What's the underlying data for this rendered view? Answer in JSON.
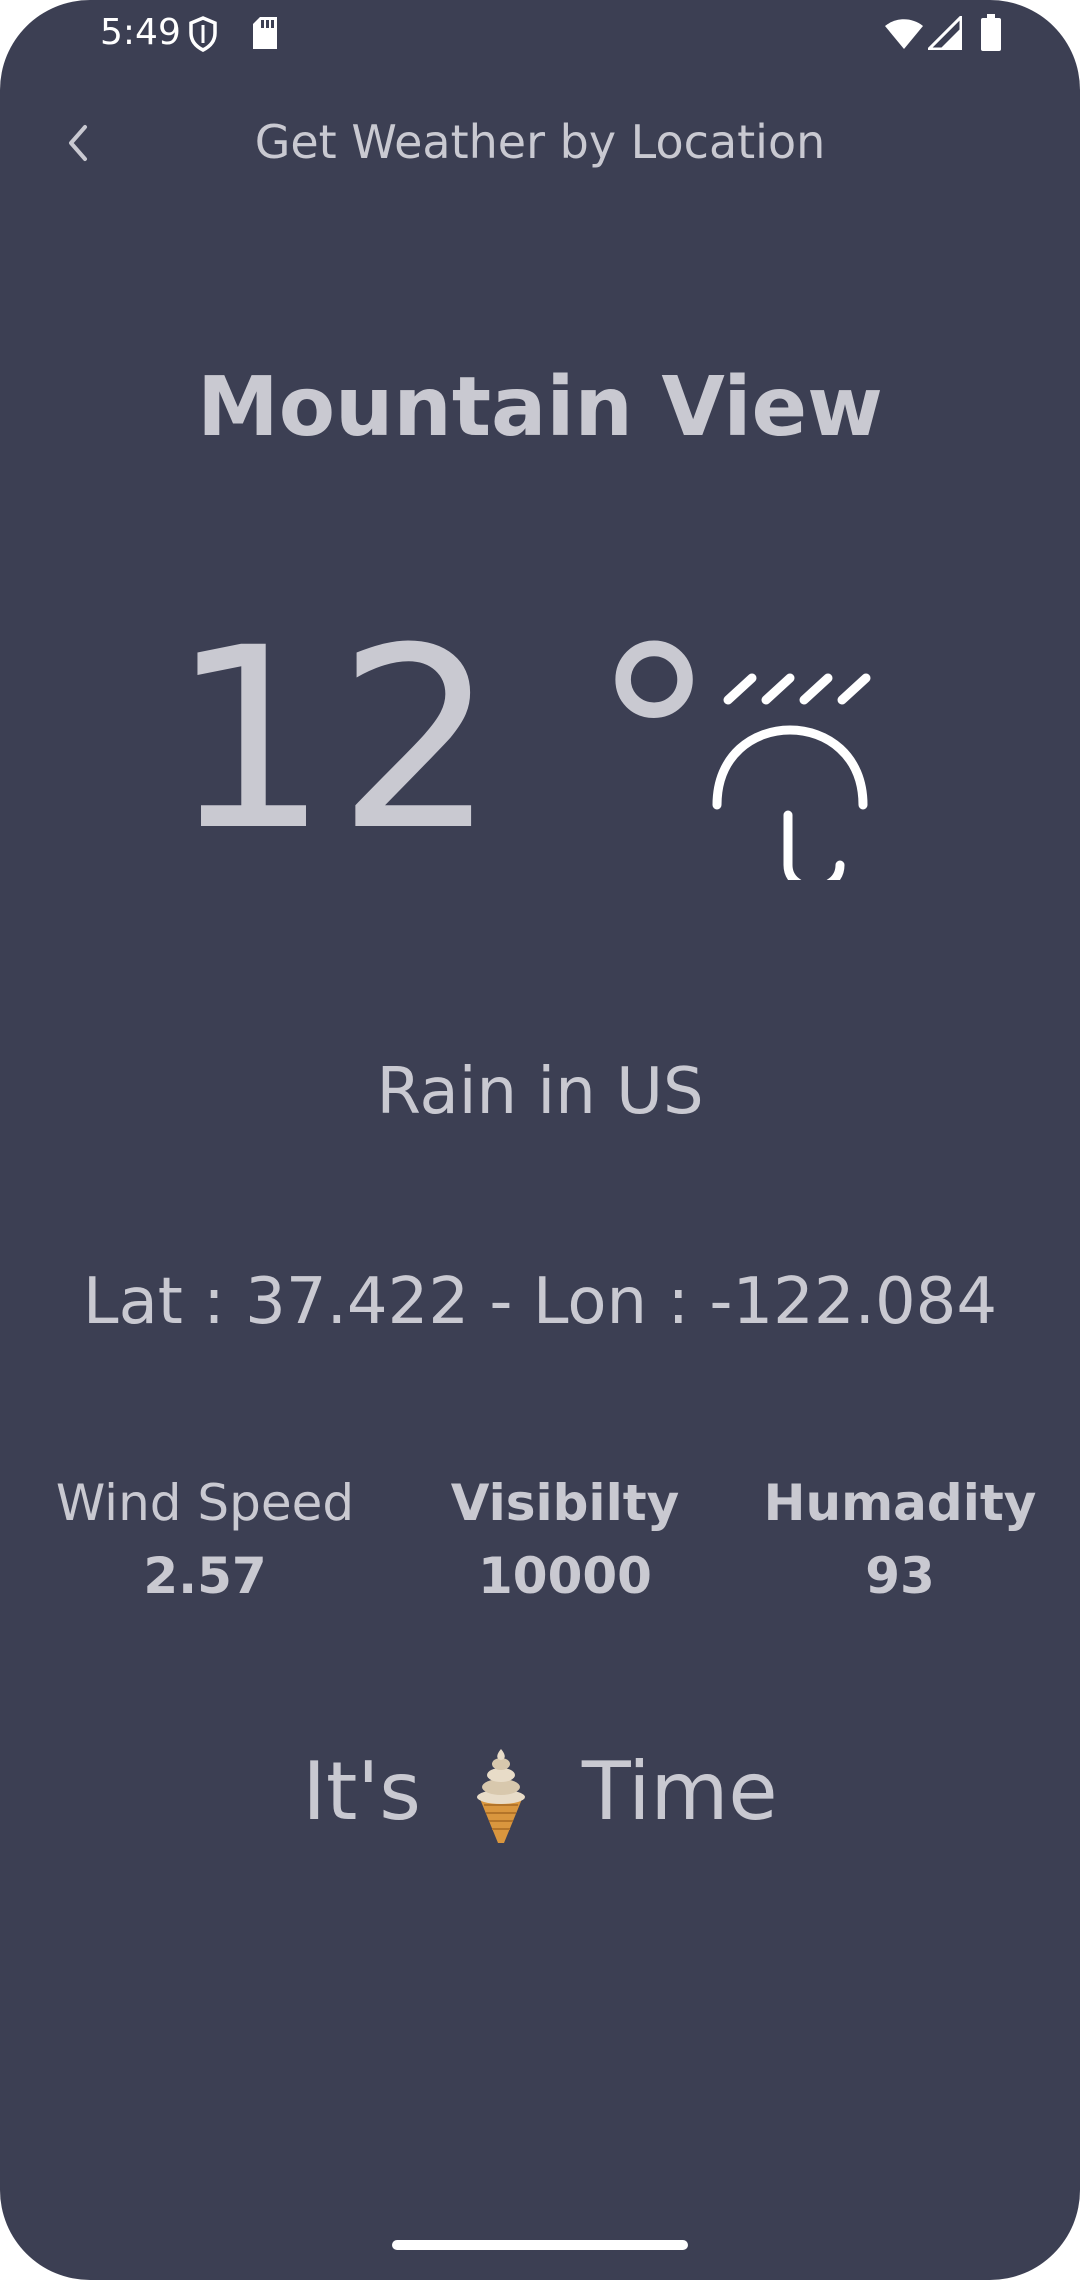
{
  "status_bar": {
    "time": "5:49",
    "icons": [
      "shield-icon",
      "sd-card-icon",
      "wifi-icon",
      "signal-icon",
      "battery-icon"
    ]
  },
  "app_bar": {
    "back_icon": "chevron-left-icon",
    "title": "Get Weather by Location"
  },
  "weather": {
    "city": "Mountain View",
    "temperature": "12 °",
    "icon": "rain-umbrella-icon",
    "condition": "Rain in US",
    "coordinates": "Lat : 37.422 - Lon : -122.084"
  },
  "stats": {
    "wind": {
      "label": "Wind Speed",
      "value": "2.57"
    },
    "visibility": {
      "label": "Visibilty",
      "value": "10000"
    },
    "humidity": {
      "label": "Humadity",
      "value": "93"
    }
  },
  "tip": {
    "prefix": "It's",
    "emoji": "ice-cream-icon",
    "suffix": "Time"
  },
  "colors": {
    "background": "#3c3f53",
    "text": "#c9c9d1",
    "icon": "#ffffff"
  }
}
